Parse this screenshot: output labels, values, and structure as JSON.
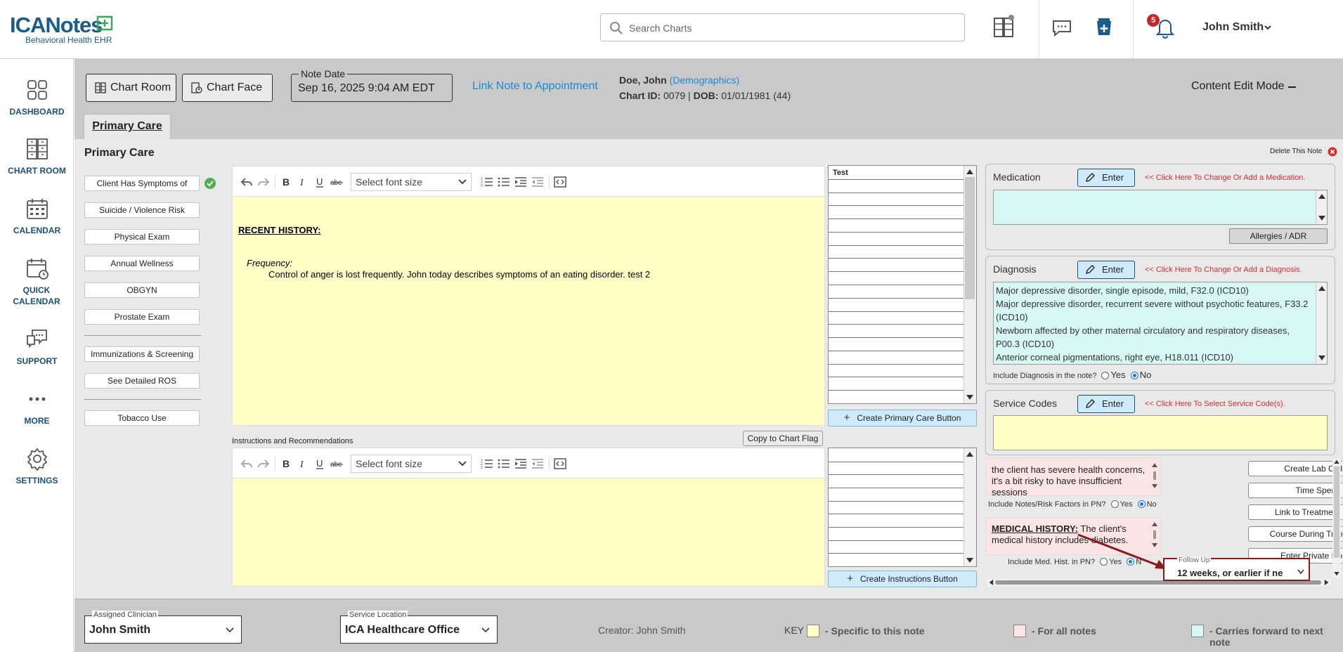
{
  "app": {
    "logo_text": "ICANotes",
    "logo_subtitle": "Behavioral Health EHR"
  },
  "topbar": {
    "search_placeholder": "Search Charts",
    "notification_count": "5",
    "user_name": "John Smith"
  },
  "leftnav": {
    "items": [
      {
        "label": "DASHBOARD",
        "icon": "dashboard-icon"
      },
      {
        "label": "CHART ROOM",
        "icon": "chart-room-icon"
      },
      {
        "label": "CALENDAR",
        "icon": "calendar-icon"
      },
      {
        "label": "QUICK CALENDAR",
        "icon": "quick-calendar-icon"
      },
      {
        "label": "SUPPORT",
        "icon": "support-icon"
      },
      {
        "label": "MORE",
        "icon": "more-icon"
      },
      {
        "label": "SETTINGS",
        "icon": "settings-icon"
      }
    ]
  },
  "header": {
    "chart_room_label": "Chart Room",
    "chart_face_label": "Chart Face",
    "note_date_legend": "Note Date",
    "note_date_value": "Sep 16, 2025 9:04 AM EDT",
    "link_appt_label": "Link Note to Appointment",
    "patient_name": "Doe, John",
    "demographics_link": "(Demographics)",
    "chart_id_label": "Chart ID:",
    "chart_id_value": "0079",
    "dob_label": "DOB:",
    "dob_value": "01/01/1981 (44)",
    "content_edit_mode": "Content Edit Mode"
  },
  "tabs": [
    {
      "label": "Primary Care"
    }
  ],
  "section": {
    "title": "Primary Care",
    "delete_note_label": "Delete This Note"
  },
  "side_buttons": [
    "Client Has Symptoms of",
    "Suicide / Violence Risk",
    "Physical Exam",
    "Annual Wellness",
    "OBGYN",
    "Prostate Exam",
    "Immunizations & Screening",
    "See Detailed ROS",
    "Tobacco Use"
  ],
  "editor1": {
    "font_size_placeholder": "Select font size",
    "heading": "RECENT HISTORY:",
    "frequency_label": "Frequency:",
    "frequency_text": "Control of anger is lost frequently. John today describes symptoms of an eating disorder. test 2"
  },
  "editor2": {
    "label": "Instructions and Recommendations",
    "copy_flag_label": "Copy to Chart Flag",
    "font_size_placeholder": "Select font size"
  },
  "button_grid1": {
    "first_cell": "Test",
    "create_label": "Create Primary Care Button"
  },
  "button_grid2": {
    "create_label": "Create Instructions Button"
  },
  "medication": {
    "title": "Medication",
    "enter_label": "Enter",
    "hint": "<< Click Here To Change Or Add a Medication.",
    "allergies_label": "Allergies / ADR"
  },
  "diagnosis": {
    "title": "Diagnosis",
    "enter_label": "Enter",
    "hint": "<< Click Here To Change Or Add a Diagnosis.",
    "items": [
      "Major depressive disorder, single episode, mild, F32.0 (ICD10)",
      "Major depressive disorder, recurrent severe without psychotic features, F33.2 (ICD10)",
      "Newborn affected by other maternal circulatory and respiratory diseases, P00.3 (ICD10)",
      "Anterior corneal pigmentations, right eye, H18.011 (ICD10)"
    ],
    "include_label": "Include Diagnosis in the note?",
    "yes": "Yes",
    "no": "No"
  },
  "service_codes": {
    "title": "Service Codes",
    "enter_label": "Enter",
    "hint": "<< Click Here To Select Service Code(s)."
  },
  "notes_risk": {
    "text": "the client has severe health concerns, it's a bit risky to have insufficient sessions",
    "include_label": "Include Notes/Risk Factors in PN?",
    "yes": "Yes",
    "no": "No"
  },
  "medical_history": {
    "heading": "MEDICAL HISTORY:",
    "text": " The client's medical history includes diabetes.",
    "include_label": "Include Med. Hist. in PN?",
    "yes": "Yes",
    "no": "N"
  },
  "action_buttons": [
    "Create Lab Order",
    "Time Spent",
    "Link to Treatment Plan",
    "Course During Treatment",
    "Enter Private Notes"
  ],
  "followup": {
    "legend": "Follow Up",
    "value": "12 weeks, or earlier if ne"
  },
  "footer": {
    "assigned_clinician_legend": "Assigned Clinician",
    "assigned_clinician_value": "John Smith",
    "service_location_legend": "Service Location",
    "service_location_value": "ICA Healthcare Office",
    "creator_label": "Creator: John Smith",
    "key_label": "KEY",
    "key_items": [
      {
        "color": "#ffffc6",
        "label": "- Specific to this note"
      },
      {
        "color": "#fbe4e4",
        "label": "- For all notes"
      },
      {
        "color": "#d7f7f5",
        "label": "- Carries forward to next note"
      }
    ]
  },
  "colors": {
    "brand": "#1a5c8a",
    "link": "#1a8ad4",
    "note_specific": "#ffffc6",
    "all_notes": "#fbe4e4",
    "carry_forward": "#d7f7f5",
    "hint_red": "#d32f2f",
    "callout": "#8b1a1a"
  }
}
